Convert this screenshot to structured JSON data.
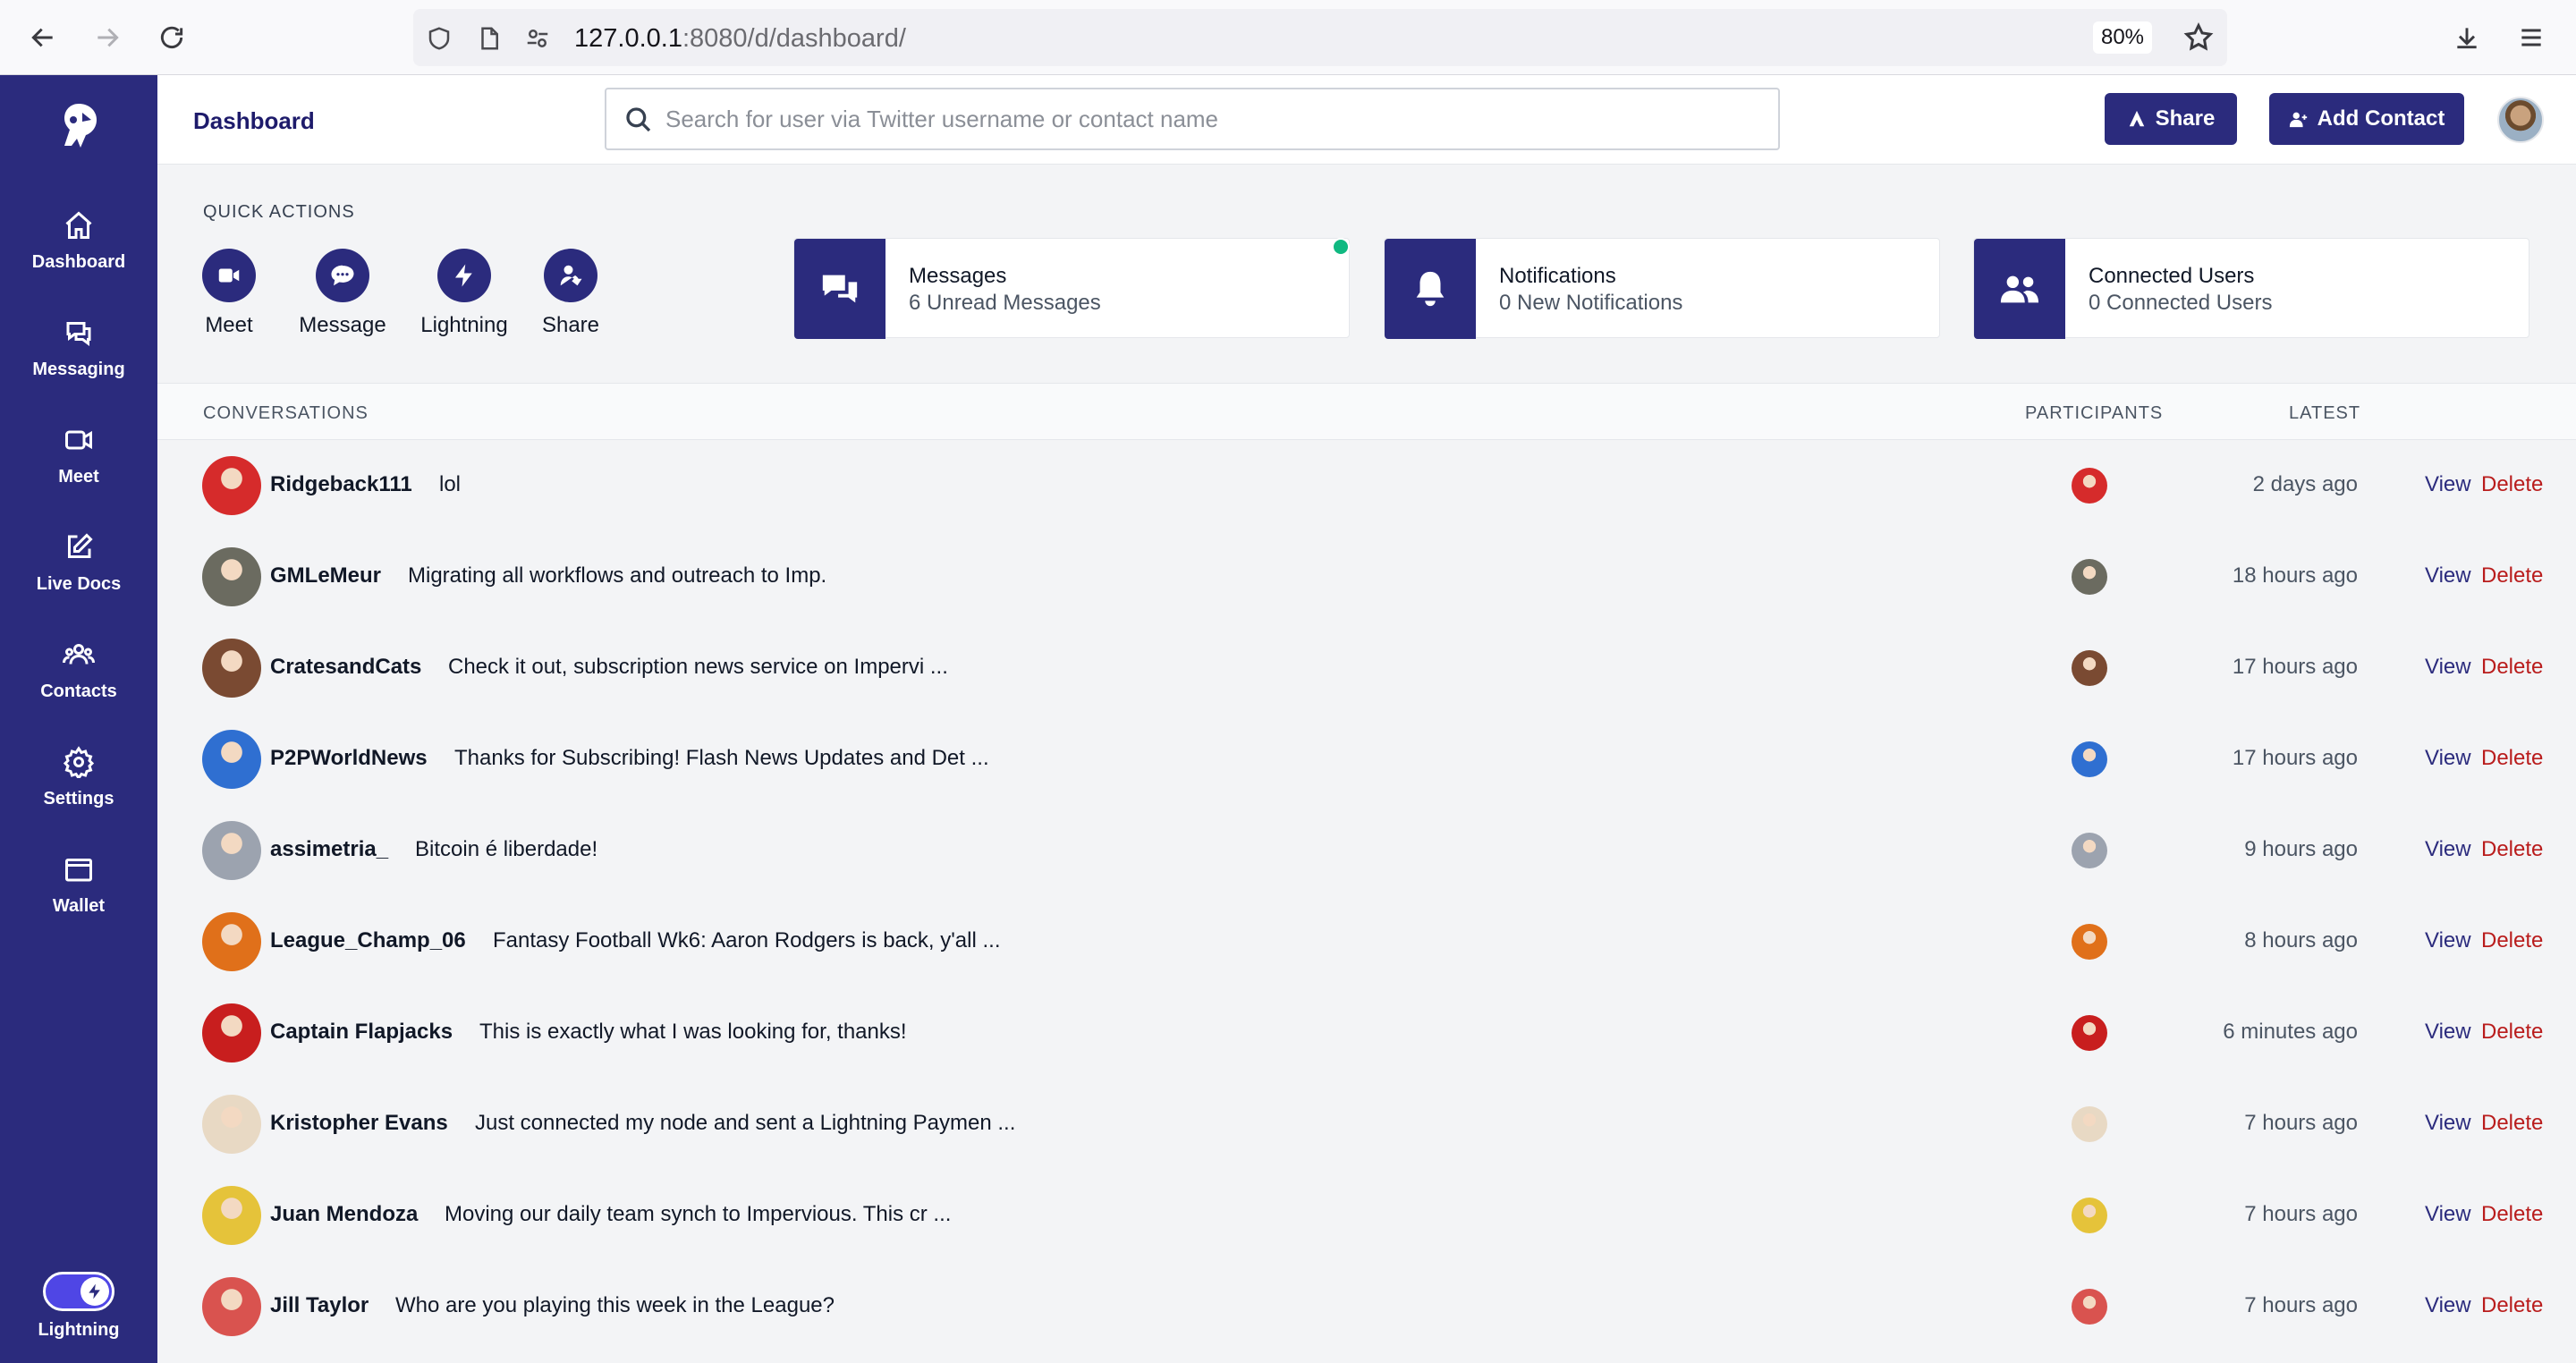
{
  "browser": {
    "url_host": "127.0.0.1",
    "url_path": ":8080/d/dashboard/",
    "zoom": "80%"
  },
  "sidebar": {
    "items": [
      {
        "label": "Dashboard",
        "icon": "home-icon"
      },
      {
        "label": "Messaging",
        "icon": "chat-icon"
      },
      {
        "label": "Meet",
        "icon": "video-icon"
      },
      {
        "label": "Live Docs",
        "icon": "edit-icon"
      },
      {
        "label": "Contacts",
        "icon": "users-icon"
      },
      {
        "label": "Settings",
        "icon": "gear-icon"
      },
      {
        "label": "Wallet",
        "icon": "wallet-icon"
      }
    ],
    "toggle_label": "Lightning"
  },
  "header": {
    "title": "Dashboard",
    "search_placeholder": "Search for user via Twitter username or contact name",
    "share_label": "Share",
    "add_contact_label": "Add Contact"
  },
  "quick_actions": {
    "title": "QUICK ACTIONS",
    "items": [
      {
        "label": "Meet",
        "icon": "video-icon"
      },
      {
        "label": "Message",
        "icon": "chat-bubble-icon"
      },
      {
        "label": "Lightning",
        "icon": "lightning-icon"
      },
      {
        "label": "Share",
        "icon": "user-share-icon"
      }
    ]
  },
  "stats": [
    {
      "title": "Messages",
      "subtitle": "6 Unread Messages",
      "icon": "comments-icon"
    },
    {
      "title": "Notifications",
      "subtitle": "0 New Notifications",
      "icon": "bell-icon"
    },
    {
      "title": "Connected Users",
      "subtitle": "0 Connected Users",
      "icon": "users-icon"
    }
  ],
  "conversations": {
    "headers": {
      "conversations": "CONVERSATIONS",
      "participants": "PARTICIPANTS",
      "latest": "LATEST"
    },
    "view_label": "View",
    "delete_label": "Delete",
    "rows": [
      {
        "name": "Ridgeback111",
        "message": "lol",
        "latest": "2 days ago",
        "avatar_color": "#d62b2b"
      },
      {
        "name": "GMLeMeur",
        "message": "Migrating all workflows and outreach to Imp.",
        "latest": "18 hours ago",
        "avatar_color": "#6b6b60"
      },
      {
        "name": "CratesandCats",
        "message": "Check it out, subscription news service on Impervi ...",
        "latest": "17 hours ago",
        "avatar_color": "#7a4a32"
      },
      {
        "name": "P2PWorldNews",
        "message": "Thanks for Subscribing! Flash News Updates and Det ...",
        "latest": "17 hours ago",
        "avatar_color": "#2f6fd1"
      },
      {
        "name": "assimetria_",
        "message": "Bitcoin é liberdade!",
        "latest": "9 hours ago",
        "avatar_color": "#9ca3af"
      },
      {
        "name": "League_Champ_06",
        "message": "Fantasy Football Wk6: Aaron Rodgers is back, y'all ...",
        "latest": "8 hours ago",
        "avatar_color": "#e0701a"
      },
      {
        "name": "Captain Flapjacks",
        "message": "This is exactly what I was looking for, thanks!",
        "latest": "6 minutes ago",
        "avatar_color": "#c81e1e"
      },
      {
        "name": "Kristopher Evans",
        "message": "Just connected my node and sent a Lightning Paymen ...",
        "latest": "7 hours ago",
        "avatar_color": "#e8d9c4"
      },
      {
        "name": "Juan Mendoza",
        "message": "Moving our daily team synch to Impervious. This cr ...",
        "latest": "7 hours ago",
        "avatar_color": "#e5c33a"
      },
      {
        "name": "Jill Taylor",
        "message": "Who are you playing this week in the League?",
        "latest": "7 hours ago",
        "avatar_color": "#d9534f"
      }
    ]
  }
}
